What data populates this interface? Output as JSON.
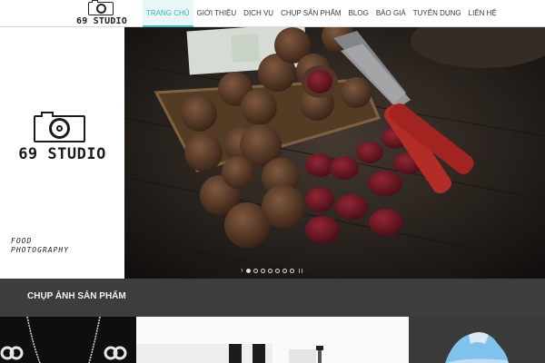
{
  "header": {
    "logo_text": "69 STUDIO",
    "nav": [
      {
        "label": "TRANG CHỦ",
        "active": true
      },
      {
        "label": "GIỚI THIỆU"
      },
      {
        "label": "DỊCH VỤ"
      },
      {
        "label": "CHỤP SẢN PHẨM"
      },
      {
        "label": "BLOG"
      },
      {
        "label": "BÁO GIÁ"
      },
      {
        "label": "TUYỂN DỤNG"
      },
      {
        "label": "LIÊN HỆ"
      }
    ]
  },
  "left_panel": {
    "brand": "69 STUDIO",
    "tagline_line1": "FOOD",
    "tagline_line2": "PHOTOGRAPHY"
  },
  "slider": {
    "slide_count": 7,
    "active_index": 0,
    "image": "walnuts-and-nutcracker-photo"
  },
  "section": {
    "title": "CHỤP ẢNH SẢN PHẨM"
  },
  "products": [
    {
      "image": "jewelry-necklace-photo"
    },
    {
      "image": "product-on-white-photo"
    },
    {
      "image": "sneaker-photo"
    }
  ],
  "colors": {
    "accent": "#3fb6bf",
    "band": "#3d3d3d",
    "nutcracker_handle": "#c4302b"
  }
}
